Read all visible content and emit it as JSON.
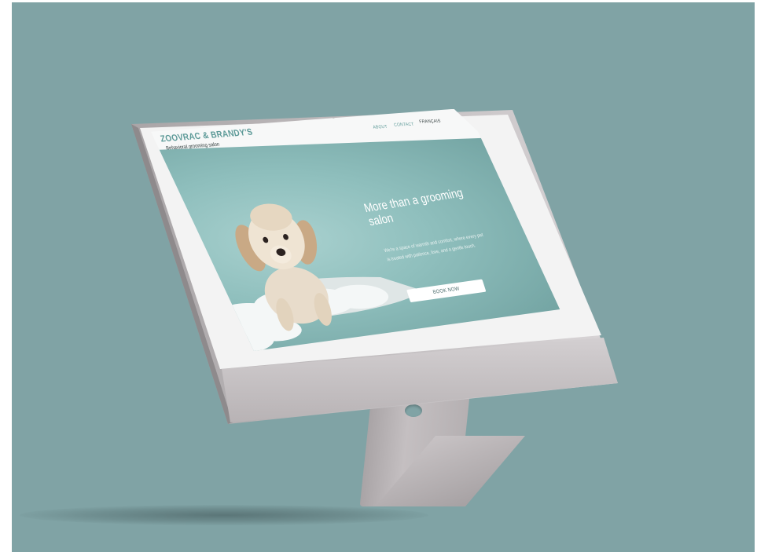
{
  "site": {
    "brand": "ZOOVRAC & BRANDY'S",
    "tagline": "Behavioral grooming salon",
    "nav": [
      "ABOUT",
      "CONTACT",
      "FRANÇAIS"
    ],
    "hero": {
      "headline": "More than a grooming salon",
      "body": "We're a space of warmth and comfort, where every pet is treated with patience, love, and a gentle touch.",
      "cta": "BOOK NOW"
    }
  },
  "colors": {
    "background": "#80a3a5",
    "accent": "#5d9a98",
    "hero": "#8fbfbd",
    "device": "#c7c2c4"
  },
  "images": {
    "hero_photo": "curly-puppy-in-bath-foam"
  }
}
